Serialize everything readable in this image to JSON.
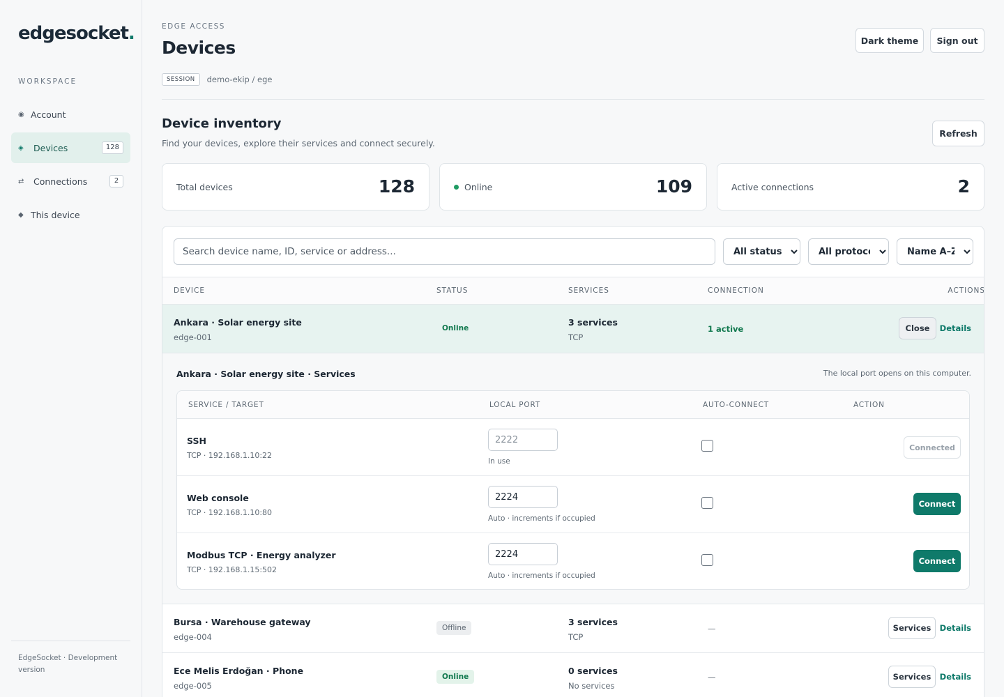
{
  "app": {
    "logo_text": "edgesocket",
    "logo_dot": ".",
    "workspace_label": "WORKSPACE",
    "footer": "EdgeSocket · Development version"
  },
  "sidebar": {
    "items": [
      {
        "icon": "account-icon",
        "glyph": "◉",
        "label": "Account",
        "count": ""
      },
      {
        "icon": "devices-icon",
        "glyph": "◈",
        "label": "Devices",
        "count": "128"
      },
      {
        "icon": "connections-icon",
        "glyph": "⇄",
        "label": "Connections",
        "count": "2"
      },
      {
        "icon": "this-device-icon",
        "glyph": "◆",
        "label": "This device",
        "count": ""
      }
    ]
  },
  "header": {
    "eyebrow": "EDGE ACCESS",
    "title": "Devices",
    "session_tag": "SESSION",
    "session_value": "demo-ekip / ege",
    "dark_theme_label": "Dark theme",
    "sign_out_label": "Sign out"
  },
  "inventory": {
    "title": "Device inventory",
    "subtitle": "Find your devices, explore their services and connect securely.",
    "refresh_label": "Refresh"
  },
  "stats": {
    "total_label": "Total devices",
    "total_value": "128",
    "online_label": "Online",
    "online_value": "109",
    "active_label": "Active connections",
    "active_value": "2"
  },
  "filters": {
    "search_placeholder": "Search device name, ID, service or address...",
    "status_selected": "All statuses",
    "protocol_selected": "All protocols",
    "sort_selected": "Name A–Z"
  },
  "table": {
    "headers": {
      "device": "DEVICE",
      "status": "STATUS",
      "services": "SERVICES",
      "connection": "CONNECTION",
      "actions": "ACTIONS"
    },
    "rows": [
      {
        "name": "Ankara · Solar energy site",
        "id": "edge-001",
        "status": "Online",
        "services": "3 services",
        "protocol": "TCP",
        "connection": "1 active",
        "action": "Close",
        "details": "Details"
      },
      {
        "name": "Bursa · Warehouse gateway",
        "id": "edge-004",
        "status": "Offline",
        "services": "3 services",
        "protocol": "TCP",
        "connection": "—",
        "action": "Services",
        "details": "Details"
      },
      {
        "name": "Ece Melis Erdoğan · Phone",
        "id": "edge-005",
        "status": "Online",
        "services": "0 services",
        "protocol": "No services",
        "connection": "—",
        "action": "Services",
        "details": "Details"
      }
    ]
  },
  "detail": {
    "title": "Ankara · Solar energy site · Services",
    "note": "The local port opens on this computer.",
    "headers": {
      "service": "SERVICE / TARGET",
      "port": "LOCAL PORT",
      "auto": "AUTO-CONNECT",
      "action": "ACTION"
    },
    "services": [
      {
        "name": "SSH",
        "target": "TCP · 192.168.1.10:22",
        "port": "2222",
        "hint": "In use",
        "action": "Connected"
      },
      {
        "name": "Web console",
        "target": "TCP · 192.168.1.10:80",
        "port": "2224",
        "hint": "Auto · increments if occupied",
        "action": "Connect"
      },
      {
        "name": "Modbus TCP · Energy analyzer",
        "target": "TCP · 192.168.1.15:502",
        "port": "2224",
        "hint": "Auto · increments if occupied",
        "action": "Connect"
      }
    ]
  },
  "colors": {
    "accent": "#0f7a6a",
    "online": "#1f9b63",
    "expanded_row": "#e7f3f0"
  }
}
